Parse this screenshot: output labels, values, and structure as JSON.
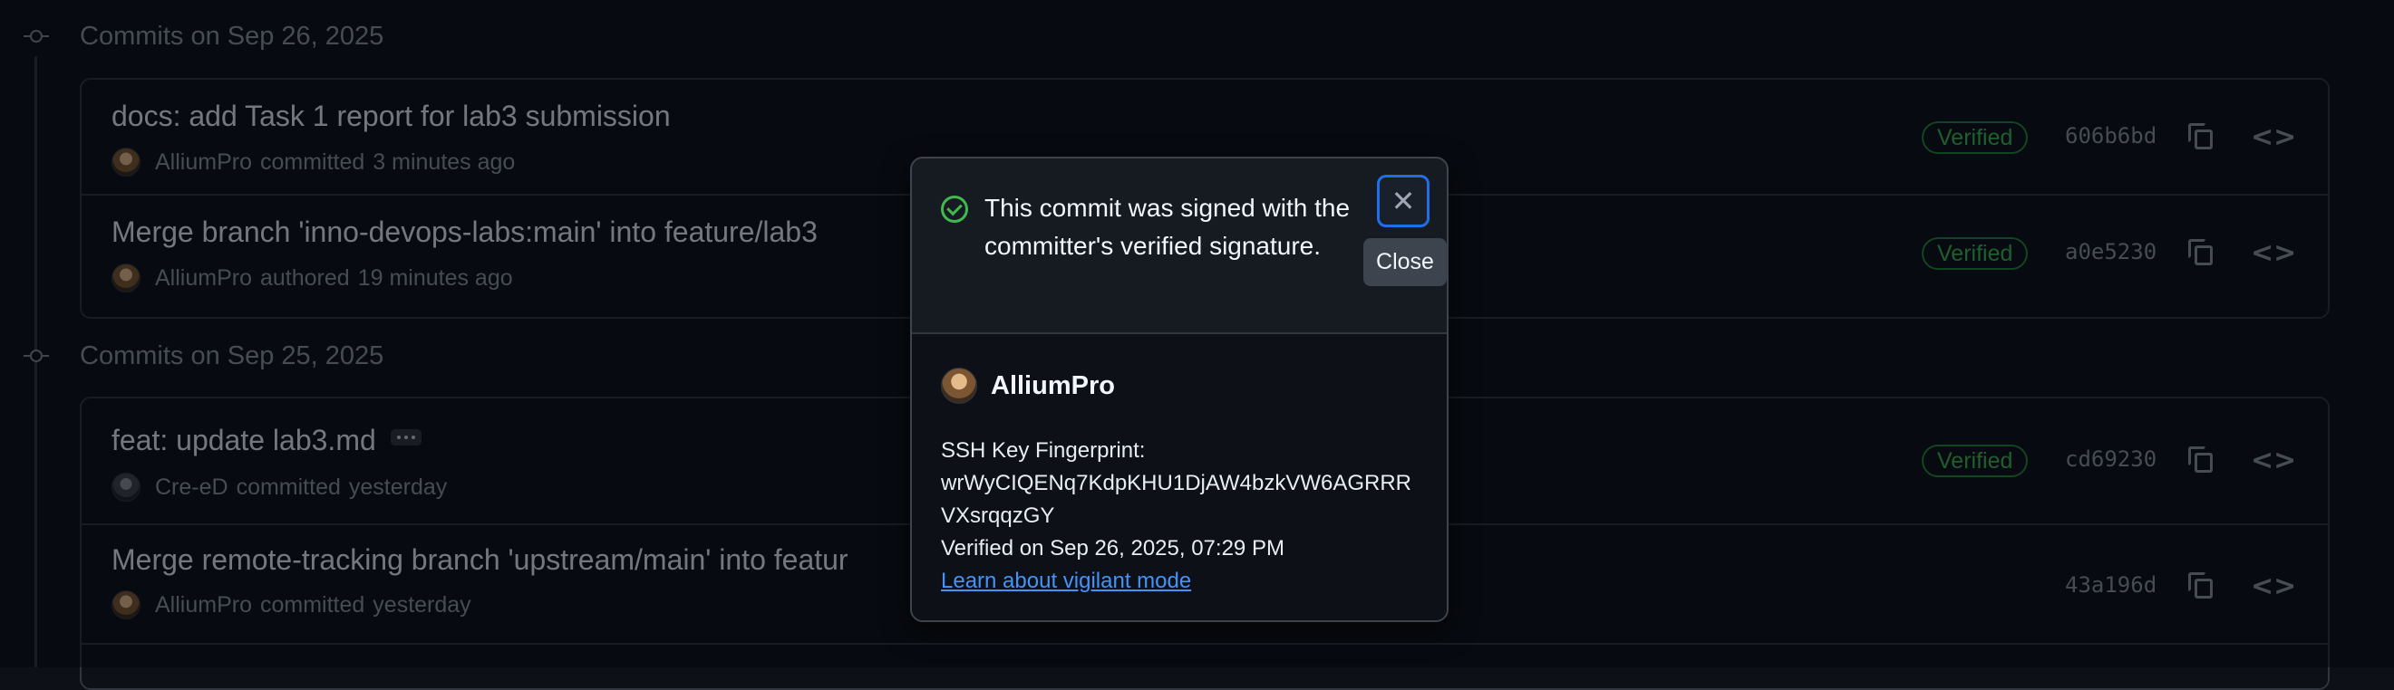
{
  "groups": [
    {
      "title": "Commits on Sep 26, 2025",
      "commits": [
        {
          "message": "docs: add Task 1 report for lab3 submission",
          "author": "AlliumPro",
          "action": "committed",
          "time": "3 minutes ago",
          "badge": "Verified",
          "sha": "606b6bd"
        },
        {
          "message": "Merge branch 'inno-devops-labs:main' into feature/lab3",
          "author": "AlliumPro",
          "action": "authored",
          "time": "19 minutes ago",
          "badge": "Verified",
          "sha": "a0e5230"
        }
      ]
    },
    {
      "title": "Commits on Sep 25, 2025",
      "commits": [
        {
          "message": "feat: update lab3.md",
          "author": "Cre-eD",
          "action": "committed",
          "time": "yesterday",
          "badge": "Verified",
          "sha": "cd69230"
        },
        {
          "message": "Merge remote-tracking branch 'upstream/main' into featur",
          "author": "AlliumPro",
          "action": "committed",
          "time": "yesterday",
          "badge": "",
          "sha": "43a196d"
        }
      ]
    }
  ],
  "popover": {
    "message": "This commit was signed with the committer's verified signature.",
    "close_tooltip": "Close",
    "close_symbol": "✕",
    "username": "AlliumPro",
    "ssh_label": "SSH Key Fingerprint:",
    "fingerprint_line1": "wrWyCIQENq7KdpKHU1DjAW4bzkVW6AGRRR",
    "fingerprint_line2": "VXsrqqzGY",
    "verified_on": "Verified on Sep 26, 2025, 07:29 PM",
    "learn_link": "Learn about vigilant mode"
  },
  "icons": {
    "code": "<>"
  },
  "colors": {
    "background": "#0d1117",
    "border": "#30363d",
    "verified_green": "#3fb950",
    "link_blue": "#4493f8",
    "focus_blue": "#1f6feb"
  }
}
